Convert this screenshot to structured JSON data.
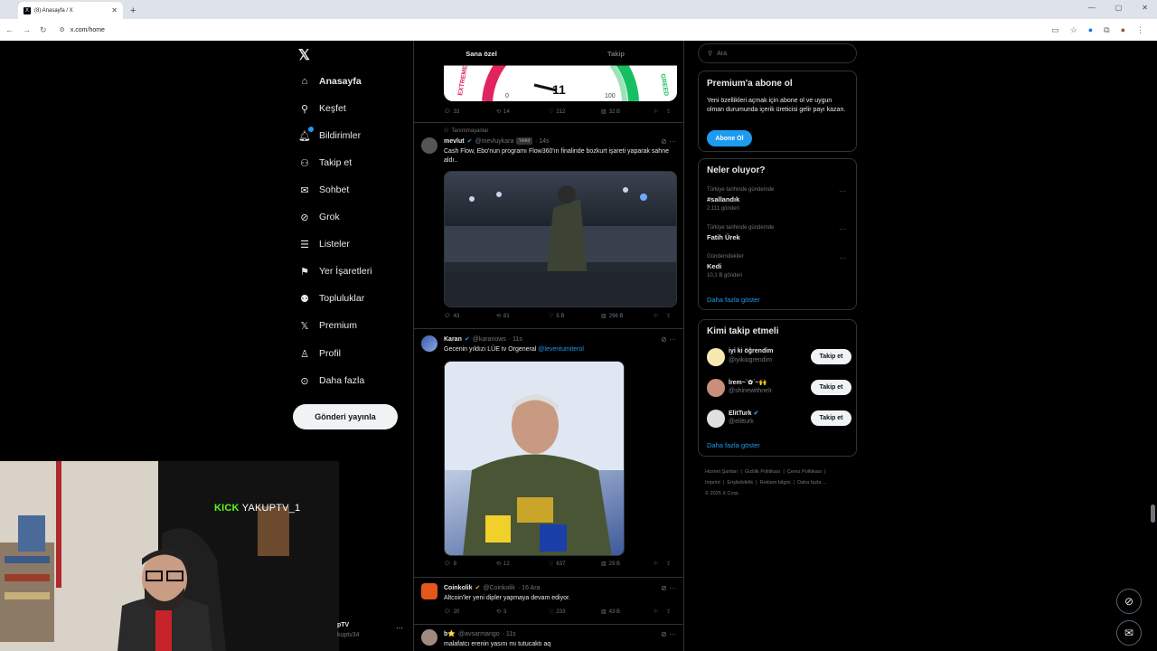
{
  "browser": {
    "tab_title": "(8) Anasayfa / X",
    "url": "x.com/home"
  },
  "nav": {
    "items": [
      {
        "label": "Anasayfa",
        "icon": "home-icon"
      },
      {
        "label": "Keşfet",
        "icon": "search-icon"
      },
      {
        "label": "Bildirimler",
        "icon": "bell-icon"
      },
      {
        "label": "Takip et",
        "icon": "person-add-icon"
      },
      {
        "label": "Sohbet",
        "icon": "mail-icon"
      },
      {
        "label": "Grok",
        "icon": "grok-icon"
      },
      {
        "label": "Listeler",
        "icon": "list-icon"
      },
      {
        "label": "Yer İşaretleri",
        "icon": "bookmark-icon"
      },
      {
        "label": "Topluluklar",
        "icon": "communities-icon"
      },
      {
        "label": "Premium",
        "icon": "x-logo-icon"
      },
      {
        "label": "Profil",
        "icon": "profile-icon"
      },
      {
        "label": "Daha fazla",
        "icon": "more-circle-icon"
      }
    ],
    "post_button": "Gönderi yayınla"
  },
  "feed": {
    "tabs": [
      "Sana özel",
      "Takip"
    ],
    "gauge": {
      "value": "11",
      "tick_left": "0",
      "tick_right": "100",
      "left_label": "EXTREME",
      "right_label": "GREED"
    },
    "tweet0_stats": {
      "replies": "33",
      "reposts": "14",
      "likes": "212",
      "views": "32 B"
    },
    "tweet1": {
      "context": "Tanımmayanlar",
      "name": "mevlut",
      "handle": "@mevluykara",
      "badge": "Vekil",
      "time": "· 14s",
      "text": "Cash Flow, Ebo'nun programı Flow360'ın finalinde bozkurt işareti yaparak sahne aldı..",
      "stats": {
        "replies": "43",
        "reposts": "81",
        "likes": "5 B",
        "views": "296 B"
      }
    },
    "tweet2": {
      "name": "Karan",
      "handle": "@karanows",
      "time": "· 11s",
      "text": "Gecenin yıldızı LÜE tv Orgeneral ",
      "mention": "@leventumiterol",
      "stats": {
        "replies": "8",
        "reposts": "12",
        "likes": "637",
        "views": "29 B"
      }
    },
    "tweet3": {
      "name": "Coinkolik",
      "handle": "@Coinkolik",
      "time": "· 16 Ara",
      "text": "Altcoin'ler yeni dipler yapmaya devam ediyor.",
      "stats": {
        "replies": "20",
        "reposts": "3",
        "likes": "233",
        "views": "43 B"
      }
    },
    "tweet4": {
      "name": "b⭐",
      "handle": "@avsarmango",
      "time": "· 11s",
      "text": "malafatcı erenin yasını mı tutucaktı aq"
    }
  },
  "sidebar": {
    "search_placeholder": "Ara",
    "premium": {
      "title": "Premium'a abone ol",
      "text": "Yeni özellikleri açmak için abone ol ve uygun olman durumunda içerik üreticisi gelir payı kazan.",
      "button": "Abone Ol"
    },
    "trends": {
      "title": "Neler oluyor?",
      "items": [
        {
          "context": "Türkiye tarihinde gündemde",
          "name": "#sallandık",
          "count": "2.111 gönderi"
        },
        {
          "context": "Türkiye tarihinde gündemde",
          "name": "Fatih Ürek",
          "count": ""
        },
        {
          "context": "Gündemdekiler",
          "name": "Kedi",
          "count": "10,1 B gönderi"
        }
      ],
      "show_more": "Daha fazla göster"
    },
    "who_to_follow": {
      "title": "Kimi takip etmeli",
      "users": [
        {
          "name": "iyi ki öğrendim",
          "handle": "@iyikiogrendim",
          "button": "Takip et"
        },
        {
          "name": "İrem~ˋ✿ˊ~🙌",
          "handle": "@shinewithnelr",
          "button": "Takip et"
        },
        {
          "name": "ElitTurk",
          "handle": "@elitturk",
          "button": "Takip et"
        }
      ],
      "show_more": "Daha fazla göster"
    },
    "footer": {
      "links": [
        "Hizmet Şartları",
        "Gizlilik Politikası",
        "Çerez Politikası",
        "Imprint",
        "Erişilebilirlik",
        "Reklam bilgisi",
        "Daha fazla ..."
      ],
      "copyright": "© 2025 X Corp."
    }
  },
  "overlay": {
    "stream_name": "YAKUPTV_1",
    "kick_label": "KICK",
    "account_name": "pTV",
    "account_handle": "kuptv34"
  }
}
